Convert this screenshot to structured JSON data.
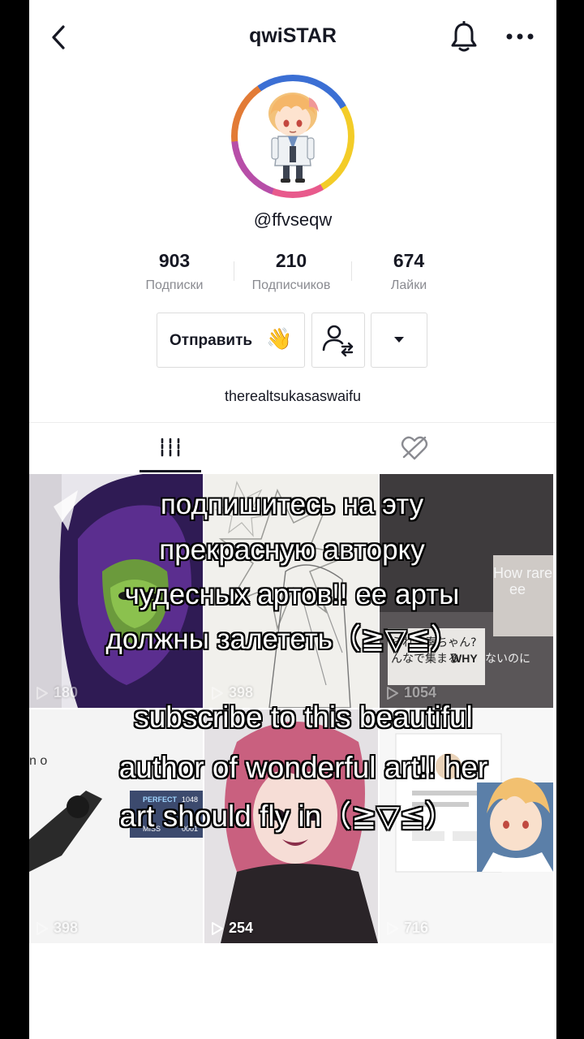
{
  "header": {
    "title": "qwiSTAR"
  },
  "profile": {
    "handle": "@ffvseqw",
    "bio": "therealtsukasaswaifu"
  },
  "stats": [
    {
      "value": "903",
      "label": "Подписки"
    },
    {
      "value": "210",
      "label": "Подписчиков"
    },
    {
      "value": "674",
      "label": "Лайки"
    }
  ],
  "actions": {
    "message_label": "Отправить",
    "message_emoji": "👋"
  },
  "videos": [
    {
      "views": "180"
    },
    {
      "views": "398"
    },
    {
      "views": "1054"
    },
    {
      "views": "398"
    },
    {
      "views": "254"
    },
    {
      "views": "716"
    }
  ],
  "tile_text": {
    "t3_a": "How rarely",
    "t3_b": "ee",
    "t3_c": "られ、奏ちゃん?",
    "t3_d": "んなで集まる",
    "t3_e": "WHY",
    "t3_f": "ないのに",
    "t4_a": "n o",
    "t4_b": "PERFECT",
    "t4_c": "1048",
    "t4_d": "MISS",
    "t4_e": "0001"
  },
  "overlay": {
    "ru_lines": [
      "подпишитесь на эту",
      "прекрасную авторку",
      "чудесных артов!! ее арты",
      "должны залететь（≧▽≦）"
    ],
    "en_lines": [
      "subscribe to this beautiful",
      "author of wonderful art!! her",
      "art should fly in（≧▽≦）"
    ]
  },
  "colors": {
    "text_primary": "#161823",
    "text_secondary": "#8a8b91",
    "divider": "#ececec"
  }
}
